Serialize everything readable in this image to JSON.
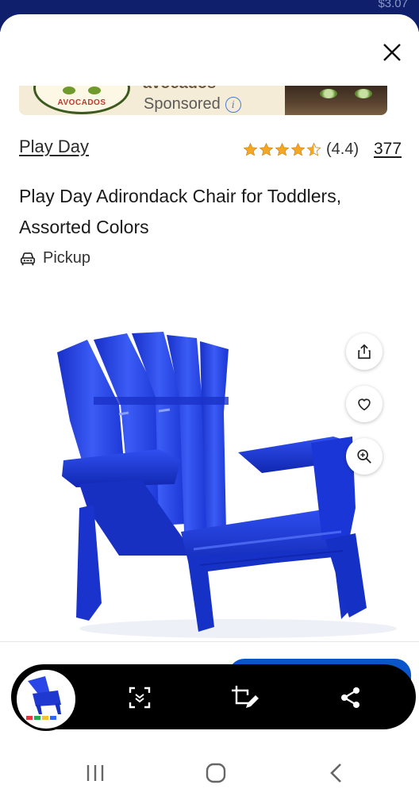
{
  "status": {
    "price_cut": "$3.07"
  },
  "ad": {
    "logo_text": "AVOCADOS",
    "headline_partial": "avocados",
    "sponsored_label": "Sponsored",
    "info_glyph": "i"
  },
  "product": {
    "brand": "Play Day",
    "rating": 4.4,
    "rating_label": "(4.4)",
    "review_count": "377",
    "title": "Play Day Adirondack Chair for Toddlers, Assorted Colors",
    "fulfillment": "Pickup",
    "image_subject": "blue toddler adirondack chair"
  },
  "actions": {
    "close_icon": "close-icon",
    "share_icon": "share-upload-icon",
    "favorite_icon": "heart-icon",
    "zoom_icon": "zoom-in-icon"
  },
  "lens_bar": {
    "tools": [
      "scan-icon",
      "crop-edit-icon",
      "share-icon"
    ]
  },
  "system_nav": [
    "recent-apps-icon",
    "home-icon",
    "back-icon"
  ],
  "colors": {
    "header_navy": "#0f1f6b",
    "star_gold": "#f5a623",
    "chair_blue": "#1f3fe0",
    "cta_blue": "#0a55c9"
  }
}
